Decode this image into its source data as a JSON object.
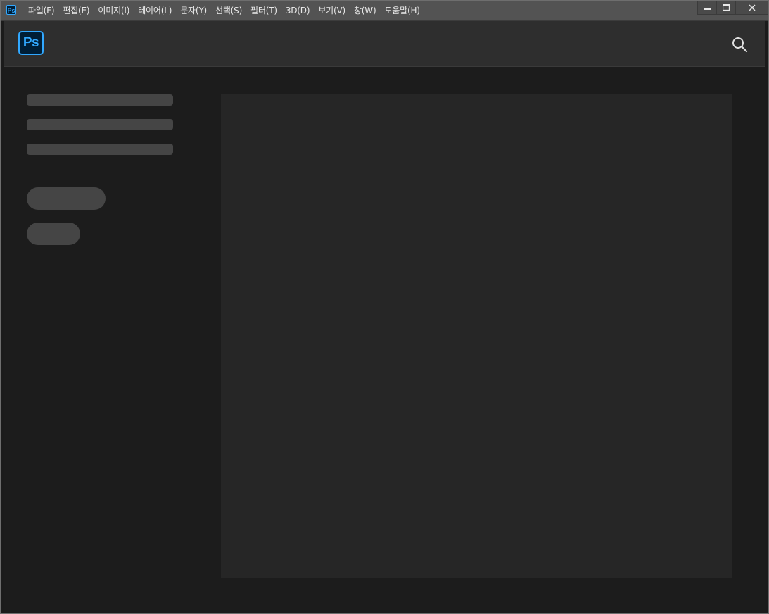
{
  "app": {
    "icon_text": "Ps",
    "menu": [
      "파일(F)",
      "편집(E)",
      "이미지(I)",
      "레이어(L)",
      "문자(Y)",
      "선택(S)",
      "필터(T)",
      "3D(D)",
      "보기(V)",
      "창(W)",
      "도움말(H)"
    ],
    "window_controls": {
      "minimize": "minimize-icon",
      "maximize": "maximize-icon",
      "close": "close-icon"
    }
  },
  "header": {
    "logo_text": "Ps",
    "search_icon": "search-icon"
  },
  "colors": {
    "accent": "#31a8ff",
    "logo_bg": "#001e36",
    "titlebar": "#535353",
    "header_bg": "#2e2e2e",
    "main_bg": "#1c1c1c",
    "placeholder": "#454545",
    "canvas_panel": "#262626"
  }
}
